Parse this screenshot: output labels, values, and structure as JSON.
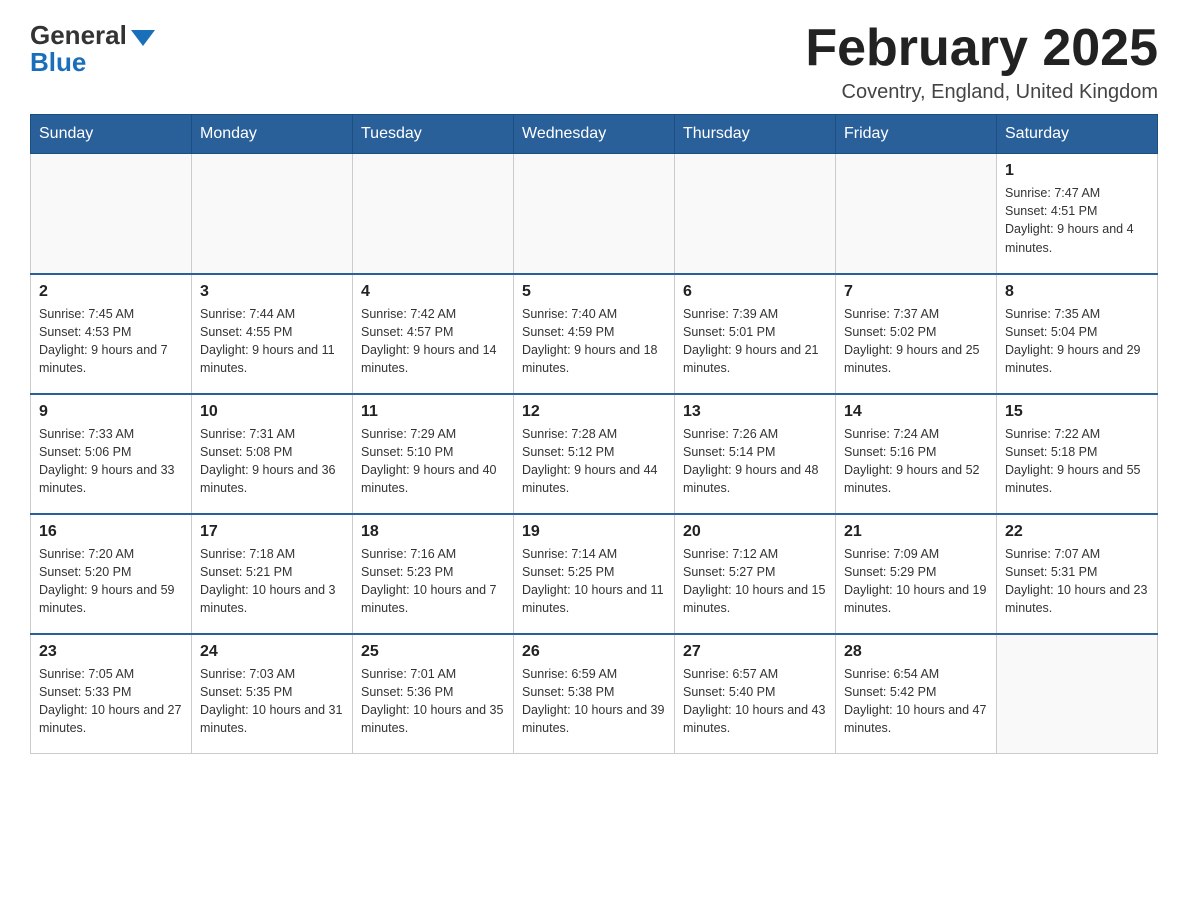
{
  "header": {
    "logo_general": "General",
    "logo_blue": "Blue",
    "month_title": "February 2025",
    "location": "Coventry, England, United Kingdom"
  },
  "days_of_week": [
    "Sunday",
    "Monday",
    "Tuesday",
    "Wednesday",
    "Thursday",
    "Friday",
    "Saturday"
  ],
  "weeks": [
    [
      {
        "day": "",
        "info": ""
      },
      {
        "day": "",
        "info": ""
      },
      {
        "day": "",
        "info": ""
      },
      {
        "day": "",
        "info": ""
      },
      {
        "day": "",
        "info": ""
      },
      {
        "day": "",
        "info": ""
      },
      {
        "day": "1",
        "info": "Sunrise: 7:47 AM\nSunset: 4:51 PM\nDaylight: 9 hours and 4 minutes."
      }
    ],
    [
      {
        "day": "2",
        "info": "Sunrise: 7:45 AM\nSunset: 4:53 PM\nDaylight: 9 hours and 7 minutes."
      },
      {
        "day": "3",
        "info": "Sunrise: 7:44 AM\nSunset: 4:55 PM\nDaylight: 9 hours and 11 minutes."
      },
      {
        "day": "4",
        "info": "Sunrise: 7:42 AM\nSunset: 4:57 PM\nDaylight: 9 hours and 14 minutes."
      },
      {
        "day": "5",
        "info": "Sunrise: 7:40 AM\nSunset: 4:59 PM\nDaylight: 9 hours and 18 minutes."
      },
      {
        "day": "6",
        "info": "Sunrise: 7:39 AM\nSunset: 5:01 PM\nDaylight: 9 hours and 21 minutes."
      },
      {
        "day": "7",
        "info": "Sunrise: 7:37 AM\nSunset: 5:02 PM\nDaylight: 9 hours and 25 minutes."
      },
      {
        "day": "8",
        "info": "Sunrise: 7:35 AM\nSunset: 5:04 PM\nDaylight: 9 hours and 29 minutes."
      }
    ],
    [
      {
        "day": "9",
        "info": "Sunrise: 7:33 AM\nSunset: 5:06 PM\nDaylight: 9 hours and 33 minutes."
      },
      {
        "day": "10",
        "info": "Sunrise: 7:31 AM\nSunset: 5:08 PM\nDaylight: 9 hours and 36 minutes."
      },
      {
        "day": "11",
        "info": "Sunrise: 7:29 AM\nSunset: 5:10 PM\nDaylight: 9 hours and 40 minutes."
      },
      {
        "day": "12",
        "info": "Sunrise: 7:28 AM\nSunset: 5:12 PM\nDaylight: 9 hours and 44 minutes."
      },
      {
        "day": "13",
        "info": "Sunrise: 7:26 AM\nSunset: 5:14 PM\nDaylight: 9 hours and 48 minutes."
      },
      {
        "day": "14",
        "info": "Sunrise: 7:24 AM\nSunset: 5:16 PM\nDaylight: 9 hours and 52 minutes."
      },
      {
        "day": "15",
        "info": "Sunrise: 7:22 AM\nSunset: 5:18 PM\nDaylight: 9 hours and 55 minutes."
      }
    ],
    [
      {
        "day": "16",
        "info": "Sunrise: 7:20 AM\nSunset: 5:20 PM\nDaylight: 9 hours and 59 minutes."
      },
      {
        "day": "17",
        "info": "Sunrise: 7:18 AM\nSunset: 5:21 PM\nDaylight: 10 hours and 3 minutes."
      },
      {
        "day": "18",
        "info": "Sunrise: 7:16 AM\nSunset: 5:23 PM\nDaylight: 10 hours and 7 minutes."
      },
      {
        "day": "19",
        "info": "Sunrise: 7:14 AM\nSunset: 5:25 PM\nDaylight: 10 hours and 11 minutes."
      },
      {
        "day": "20",
        "info": "Sunrise: 7:12 AM\nSunset: 5:27 PM\nDaylight: 10 hours and 15 minutes."
      },
      {
        "day": "21",
        "info": "Sunrise: 7:09 AM\nSunset: 5:29 PM\nDaylight: 10 hours and 19 minutes."
      },
      {
        "day": "22",
        "info": "Sunrise: 7:07 AM\nSunset: 5:31 PM\nDaylight: 10 hours and 23 minutes."
      }
    ],
    [
      {
        "day": "23",
        "info": "Sunrise: 7:05 AM\nSunset: 5:33 PM\nDaylight: 10 hours and 27 minutes."
      },
      {
        "day": "24",
        "info": "Sunrise: 7:03 AM\nSunset: 5:35 PM\nDaylight: 10 hours and 31 minutes."
      },
      {
        "day": "25",
        "info": "Sunrise: 7:01 AM\nSunset: 5:36 PM\nDaylight: 10 hours and 35 minutes."
      },
      {
        "day": "26",
        "info": "Sunrise: 6:59 AM\nSunset: 5:38 PM\nDaylight: 10 hours and 39 minutes."
      },
      {
        "day": "27",
        "info": "Sunrise: 6:57 AM\nSunset: 5:40 PM\nDaylight: 10 hours and 43 minutes."
      },
      {
        "day": "28",
        "info": "Sunrise: 6:54 AM\nSunset: 5:42 PM\nDaylight: 10 hours and 47 minutes."
      },
      {
        "day": "",
        "info": ""
      }
    ]
  ]
}
